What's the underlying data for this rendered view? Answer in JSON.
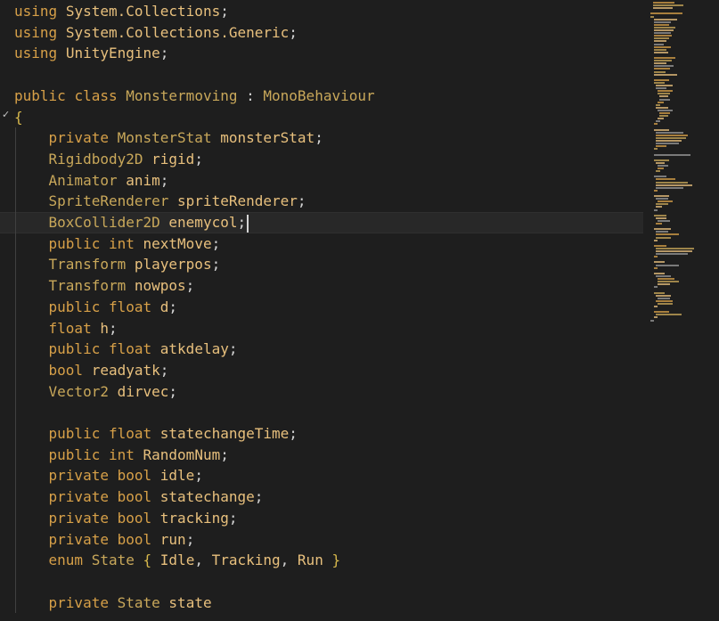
{
  "editor": {
    "language": "C#",
    "theme_colors": {
      "background": "#1e1e1e",
      "keyword": "#d7a048",
      "type": "#c9a85a",
      "identifier": "#e8c07d",
      "punctuation": "#d4d4d4",
      "current_line": "#282828"
    },
    "cursor_line_index": 10,
    "lines": [
      [
        {
          "t": "kw",
          "s": "using"
        },
        {
          "t": "pl",
          "s": " "
        },
        {
          "t": "nm",
          "s": "System.Collections"
        },
        {
          "t": "pl",
          "s": ";"
        }
      ],
      [
        {
          "t": "kw",
          "s": "using"
        },
        {
          "t": "pl",
          "s": " "
        },
        {
          "t": "nm",
          "s": "System.Collections.Generic"
        },
        {
          "t": "pl",
          "s": ";"
        }
      ],
      [
        {
          "t": "kw",
          "s": "using"
        },
        {
          "t": "pl",
          "s": " "
        },
        {
          "t": "nm",
          "s": "UnityEngine"
        },
        {
          "t": "pl",
          "s": ";"
        }
      ],
      [],
      [
        {
          "t": "kw",
          "s": "public"
        },
        {
          "t": "pl",
          "s": " "
        },
        {
          "t": "kw",
          "s": "class"
        },
        {
          "t": "pl",
          "s": " "
        },
        {
          "t": "ty",
          "s": "Monstermoving"
        },
        {
          "t": "pl",
          "s": " : "
        },
        {
          "t": "ty",
          "s": "MonoBehaviour"
        }
      ],
      [
        {
          "t": "br",
          "s": "{"
        }
      ],
      [
        {
          "t": "pl",
          "s": "    "
        },
        {
          "t": "kw",
          "s": "private"
        },
        {
          "t": "pl",
          "s": " "
        },
        {
          "t": "ty",
          "s": "MonsterStat"
        },
        {
          "t": "pl",
          "s": " "
        },
        {
          "t": "nm",
          "s": "monsterStat"
        },
        {
          "t": "pl",
          "s": ";"
        }
      ],
      [
        {
          "t": "pl",
          "s": "    "
        },
        {
          "t": "ty",
          "s": "Rigidbody2D"
        },
        {
          "t": "pl",
          "s": " "
        },
        {
          "t": "nm",
          "s": "rigid"
        },
        {
          "t": "pl",
          "s": ";"
        }
      ],
      [
        {
          "t": "pl",
          "s": "    "
        },
        {
          "t": "ty",
          "s": "Animator"
        },
        {
          "t": "pl",
          "s": " "
        },
        {
          "t": "nm",
          "s": "anim"
        },
        {
          "t": "pl",
          "s": ";"
        }
      ],
      [
        {
          "t": "pl",
          "s": "    "
        },
        {
          "t": "ty",
          "s": "SpriteRenderer"
        },
        {
          "t": "pl",
          "s": " "
        },
        {
          "t": "nm",
          "s": "spriteRenderer"
        },
        {
          "t": "pl",
          "s": ";"
        }
      ],
      [
        {
          "t": "pl",
          "s": "    "
        },
        {
          "t": "ty",
          "s": "BoxCollider2D"
        },
        {
          "t": "pl",
          "s": " "
        },
        {
          "t": "nm",
          "s": "enemycol"
        },
        {
          "t": "pl",
          "s": ";"
        }
      ],
      [
        {
          "t": "pl",
          "s": "    "
        },
        {
          "t": "kw",
          "s": "public"
        },
        {
          "t": "pl",
          "s": " "
        },
        {
          "t": "kw",
          "s": "int"
        },
        {
          "t": "pl",
          "s": " "
        },
        {
          "t": "nm",
          "s": "nextMove"
        },
        {
          "t": "pl",
          "s": ";"
        }
      ],
      [
        {
          "t": "pl",
          "s": "    "
        },
        {
          "t": "ty",
          "s": "Transform"
        },
        {
          "t": "pl",
          "s": " "
        },
        {
          "t": "nm",
          "s": "playerpos"
        },
        {
          "t": "pl",
          "s": ";"
        }
      ],
      [
        {
          "t": "pl",
          "s": "    "
        },
        {
          "t": "ty",
          "s": "Transform"
        },
        {
          "t": "pl",
          "s": " "
        },
        {
          "t": "nm",
          "s": "nowpos"
        },
        {
          "t": "pl",
          "s": ";"
        }
      ],
      [
        {
          "t": "pl",
          "s": "    "
        },
        {
          "t": "kw",
          "s": "public"
        },
        {
          "t": "pl",
          "s": " "
        },
        {
          "t": "kw",
          "s": "float"
        },
        {
          "t": "pl",
          "s": " "
        },
        {
          "t": "nm",
          "s": "d"
        },
        {
          "t": "pl",
          "s": ";"
        }
      ],
      [
        {
          "t": "pl",
          "s": "    "
        },
        {
          "t": "kw",
          "s": "float"
        },
        {
          "t": "pl",
          "s": " "
        },
        {
          "t": "nm",
          "s": "h"
        },
        {
          "t": "pl",
          "s": ";"
        }
      ],
      [
        {
          "t": "pl",
          "s": "    "
        },
        {
          "t": "kw",
          "s": "public"
        },
        {
          "t": "pl",
          "s": " "
        },
        {
          "t": "kw",
          "s": "float"
        },
        {
          "t": "pl",
          "s": " "
        },
        {
          "t": "nm",
          "s": "atkdelay"
        },
        {
          "t": "pl",
          "s": ";"
        }
      ],
      [
        {
          "t": "pl",
          "s": "    "
        },
        {
          "t": "kw",
          "s": "bool"
        },
        {
          "t": "pl",
          "s": " "
        },
        {
          "t": "nm",
          "s": "readyatk"
        },
        {
          "t": "pl",
          "s": ";"
        }
      ],
      [
        {
          "t": "pl",
          "s": "    "
        },
        {
          "t": "ty",
          "s": "Vector2"
        },
        {
          "t": "pl",
          "s": " "
        },
        {
          "t": "nm",
          "s": "dirvec"
        },
        {
          "t": "pl",
          "s": ";"
        }
      ],
      [],
      [
        {
          "t": "pl",
          "s": "    "
        },
        {
          "t": "kw",
          "s": "public"
        },
        {
          "t": "pl",
          "s": " "
        },
        {
          "t": "kw",
          "s": "float"
        },
        {
          "t": "pl",
          "s": " "
        },
        {
          "t": "nm",
          "s": "statechangeTime"
        },
        {
          "t": "pl",
          "s": ";"
        }
      ],
      [
        {
          "t": "pl",
          "s": "    "
        },
        {
          "t": "kw",
          "s": "public"
        },
        {
          "t": "pl",
          "s": " "
        },
        {
          "t": "kw",
          "s": "int"
        },
        {
          "t": "pl",
          "s": " "
        },
        {
          "t": "nm",
          "s": "RandomNum"
        },
        {
          "t": "pl",
          "s": ";"
        }
      ],
      [
        {
          "t": "pl",
          "s": "    "
        },
        {
          "t": "kw",
          "s": "private"
        },
        {
          "t": "pl",
          "s": " "
        },
        {
          "t": "kw",
          "s": "bool"
        },
        {
          "t": "pl",
          "s": " "
        },
        {
          "t": "nm",
          "s": "idle"
        },
        {
          "t": "pl",
          "s": ";"
        }
      ],
      [
        {
          "t": "pl",
          "s": "    "
        },
        {
          "t": "kw",
          "s": "private"
        },
        {
          "t": "pl",
          "s": " "
        },
        {
          "t": "kw",
          "s": "bool"
        },
        {
          "t": "pl",
          "s": " "
        },
        {
          "t": "nm",
          "s": "statechange"
        },
        {
          "t": "pl",
          "s": ";"
        }
      ],
      [
        {
          "t": "pl",
          "s": "    "
        },
        {
          "t": "kw",
          "s": "private"
        },
        {
          "t": "pl",
          "s": " "
        },
        {
          "t": "kw",
          "s": "bool"
        },
        {
          "t": "pl",
          "s": " "
        },
        {
          "t": "nm",
          "s": "tracking"
        },
        {
          "t": "pl",
          "s": ";"
        }
      ],
      [
        {
          "t": "pl",
          "s": "    "
        },
        {
          "t": "kw",
          "s": "private"
        },
        {
          "t": "pl",
          "s": " "
        },
        {
          "t": "kw",
          "s": "bool"
        },
        {
          "t": "pl",
          "s": " "
        },
        {
          "t": "nm",
          "s": "run"
        },
        {
          "t": "pl",
          "s": ";"
        }
      ],
      [
        {
          "t": "pl",
          "s": "    "
        },
        {
          "t": "kw",
          "s": "enum"
        },
        {
          "t": "pl",
          "s": " "
        },
        {
          "t": "ty",
          "s": "State"
        },
        {
          "t": "pl",
          "s": " "
        },
        {
          "t": "br",
          "s": "{"
        },
        {
          "t": "pl",
          "s": " "
        },
        {
          "t": "nm",
          "s": "Idle"
        },
        {
          "t": "pl",
          "s": ", "
        },
        {
          "t": "nm",
          "s": "Tracking"
        },
        {
          "t": "pl",
          "s": ", "
        },
        {
          "t": "nm",
          "s": "Run"
        },
        {
          "t": "pl",
          "s": " "
        },
        {
          "t": "br",
          "s": "}"
        }
      ],
      [],
      [
        {
          "t": "pl",
          "s": "    "
        },
        {
          "t": "kw",
          "s": "private"
        },
        {
          "t": "pl",
          "s": " "
        },
        {
          "t": "ty",
          "s": "State"
        },
        {
          "t": "pl",
          "s": " "
        },
        {
          "t": "nm",
          "s": "state"
        }
      ]
    ]
  }
}
